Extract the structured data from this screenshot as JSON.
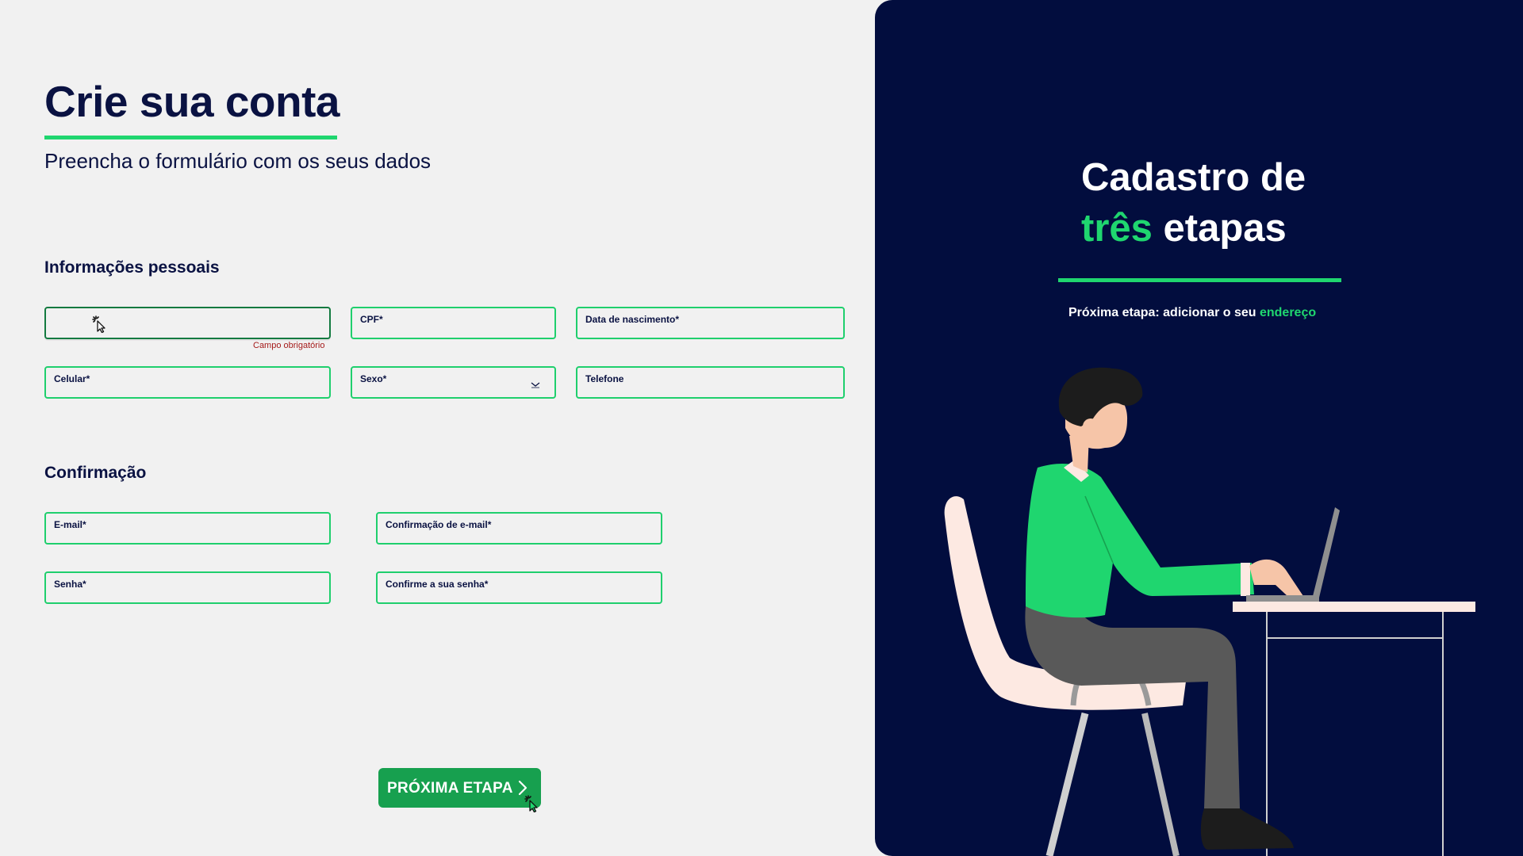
{
  "form": {
    "title": "Crie sua conta",
    "subtitle": "Preencha o formulário com os seus dados",
    "personal_section": "Informações pessoais",
    "confirmation_section": "Confirmação",
    "fields": {
      "name": {
        "label": "",
        "error": "Campo obrigatório"
      },
      "cpf": {
        "label": "CPF*"
      },
      "birthdate": {
        "label": "Data de nascimento*"
      },
      "mobile": {
        "label": "Celular*"
      },
      "sex": {
        "label": "Sexo*"
      },
      "phone": {
        "label": "Telefone"
      },
      "email": {
        "label": "E-mail*"
      },
      "email_confirm": {
        "label": "Confirmação de e-mail*"
      },
      "password": {
        "label": "Senha*"
      },
      "password_confirm": {
        "label": "Confirme a sua senha*"
      }
    },
    "next_button": "PRÓXIMA ETAPA"
  },
  "side_panel": {
    "heading_line1": "Cadastro de",
    "heading_highlight": "três",
    "heading_rest": "etapas",
    "next_step_text": "Próxima etapa: adicionar o seu",
    "next_step_highlight": "endereço"
  },
  "colors": {
    "accent_green": "#1fd66f",
    "button_green": "#17a04f",
    "navy": "#020d3e",
    "error_red": "#a51b1b",
    "page_bg": "#f1f1f1"
  },
  "icons": [
    "loading-cursor-icon",
    "chevron-down-icon",
    "chevron-right-icon"
  ]
}
